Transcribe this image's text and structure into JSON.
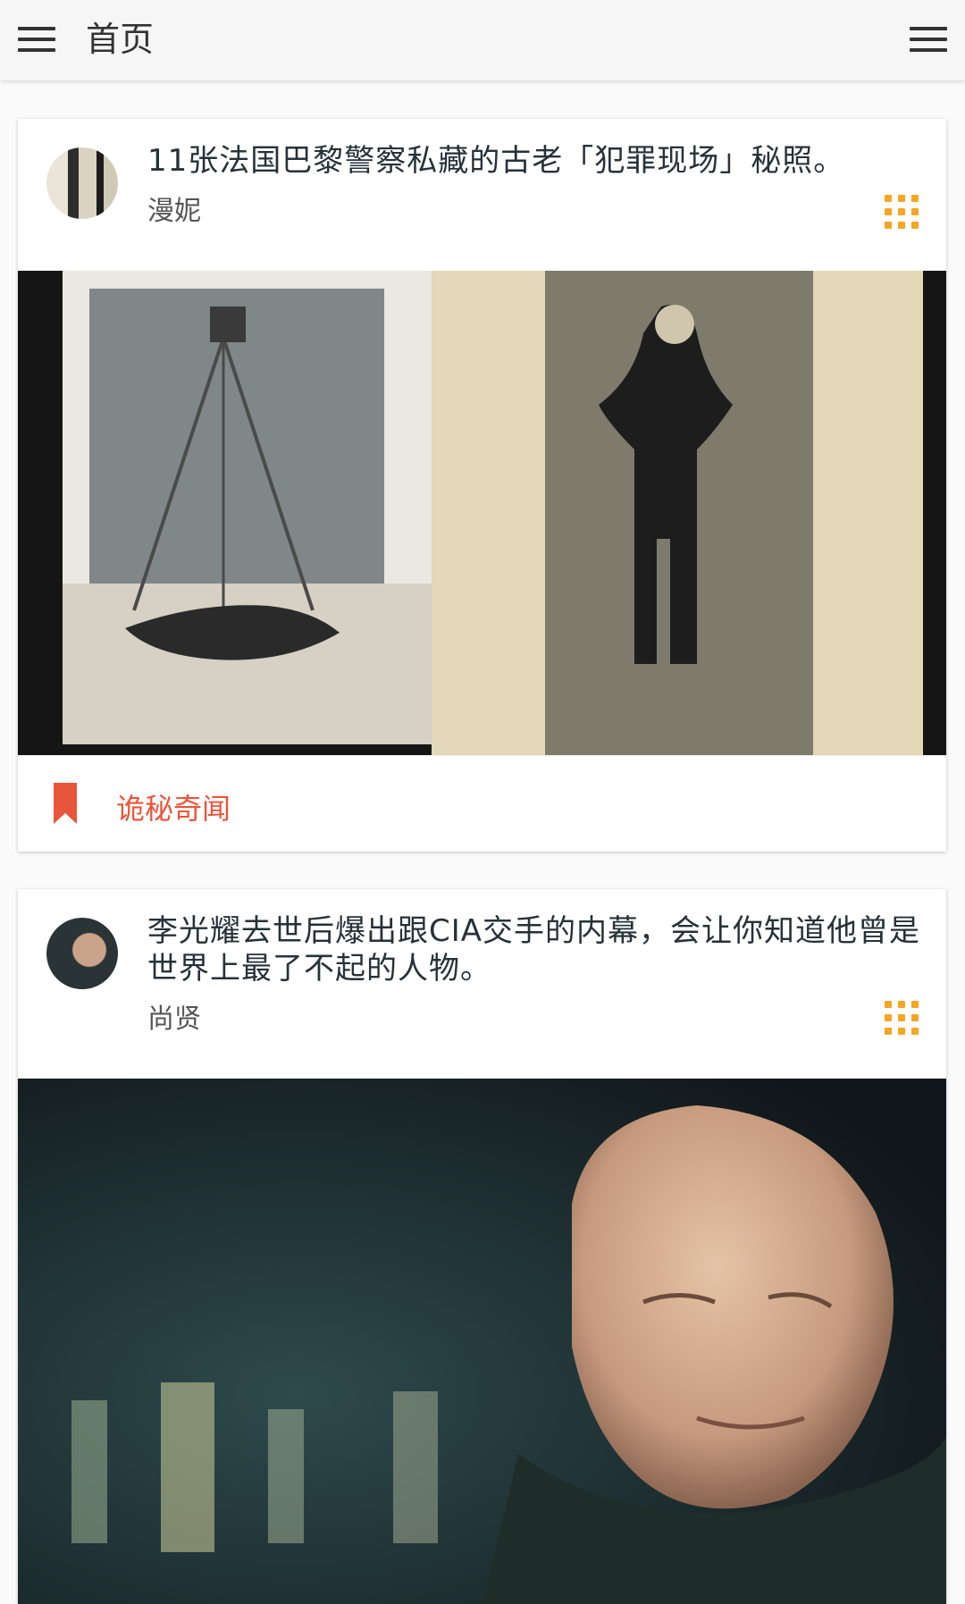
{
  "appbar": {
    "title": "首页",
    "menu_icon": "hamburger-menu-icon",
    "overflow_icon": "hamburger-menu-icon"
  },
  "colors": {
    "accent": "#f5a623",
    "category": "#e9553b",
    "title_text": "#263238"
  },
  "posts": [
    {
      "title": "11张法国巴黎警察私藏的古老「犯罪现场」秘照。",
      "author": "漫妮",
      "category": "诡秘奇闻",
      "category_icon": "bookmark-icon",
      "action_icon": "grid-dots-icon"
    },
    {
      "title": "李光耀去世后爆出跟CIA交手的内幕，会让你知道他曾是世界上最了不起的人物。",
      "author": "尚贤",
      "action_icon": "grid-dots-icon"
    }
  ]
}
